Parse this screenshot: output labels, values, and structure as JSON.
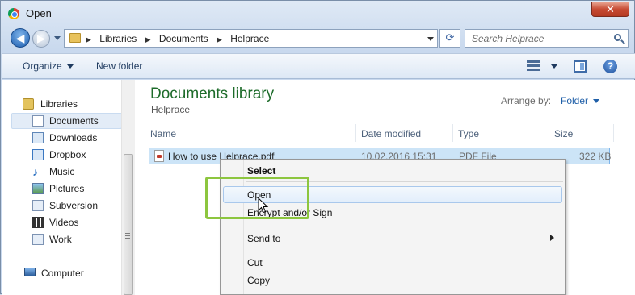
{
  "window": {
    "title": "Open",
    "close_glyph": "✕"
  },
  "nav": {
    "back_glyph": "◀",
    "forward_glyph": "▶"
  },
  "address": {
    "crumbs": [
      "Libraries",
      "Documents",
      "Helprace"
    ],
    "separator": "▶",
    "refresh_glyph": "⟳"
  },
  "search": {
    "placeholder": "Search Helprace"
  },
  "toolbar": {
    "organize_label": "Organize",
    "new_folder_label": "New folder",
    "help_glyph": "?"
  },
  "sidebar": {
    "items": [
      {
        "label": "Libraries",
        "icon": "libraries-icon"
      },
      {
        "label": "Documents",
        "icon": "documents-icon"
      },
      {
        "label": "Downloads",
        "icon": "downloads-icon"
      },
      {
        "label": "Dropbox",
        "icon": "dropbox-icon"
      },
      {
        "label": "Music",
        "icon": "music-icon"
      },
      {
        "label": "Pictures",
        "icon": "pictures-icon"
      },
      {
        "label": "Subversion",
        "icon": "subversion-icon"
      },
      {
        "label": "Videos",
        "icon": "videos-icon"
      },
      {
        "label": "Work",
        "icon": "work-icon"
      },
      {
        "label": "Computer",
        "icon": "computer-icon"
      }
    ],
    "selected": "Documents"
  },
  "library": {
    "title": "Documents library",
    "subtitle": "Helprace",
    "arrange_label": "Arrange by:",
    "arrange_value": "Folder"
  },
  "columns": [
    "Name",
    "Date modified",
    "Type",
    "Size"
  ],
  "files": [
    {
      "name": "How to use Helprace.pdf",
      "date": "10.02.2016 15:31",
      "type": "PDF File",
      "size": "322 KB"
    }
  ],
  "context_menu": {
    "items": [
      "Select",
      "Open",
      "Encrypt and/or Sign",
      "Send to",
      "Cut",
      "Copy"
    ],
    "highlighted": "Open"
  },
  "colors": {
    "accent_green": "#8dc63f",
    "library_title": "#1e6c2b",
    "link_blue": "#1f5fa8"
  }
}
